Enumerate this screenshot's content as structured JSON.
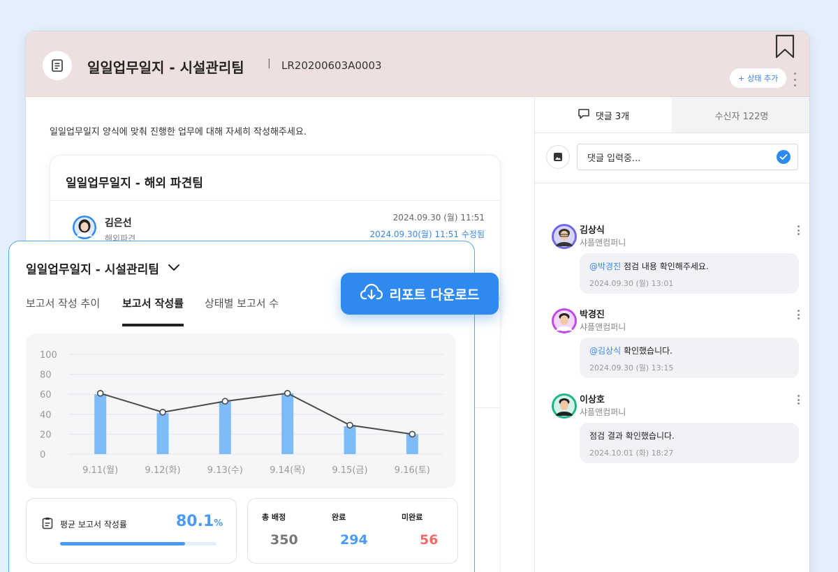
{
  "header": {
    "title": "일일업무일지 - 시설관리팀",
    "separator": "|",
    "doc_id": "LR20200603A0003",
    "status_button": "상태 추가",
    "status_plus": "+"
  },
  "main": {
    "instruction": "일일업무일지 양식에 맞춰 진행한 업무에 대해 자세히 작성해주세요.",
    "report": {
      "title": "일일업무일지 - 해외 파견팀",
      "author": "김은선",
      "team": "해외파견",
      "date": "2024.09.30 (월) 11:51",
      "edited": "2024.09.30(월) 11:51 수정됨"
    }
  },
  "side": {
    "tab_comments": "댓글 3개",
    "tab_recipients": "수신자 122명",
    "input_value": "댓글 입력중...",
    "comments": [
      {
        "name": "김상식",
        "company": "샤플앤컴퍼니",
        "mention": "@박경진",
        "text": " 점검 내용 확인해주세요.",
        "time": "2024.09.30 (월) 13:01"
      },
      {
        "name": "박경진",
        "company": "샤플앤컴퍼니",
        "mention": "@김상식",
        "text": " 확인했습니다.",
        "time": "2024.09.30 (월) 13:15"
      },
      {
        "name": "이상호",
        "company": "샤플앤컴퍼니",
        "mention": "",
        "text": "점검 결과 확인했습니다.",
        "time": "2024.10.01 (화) 18:27"
      }
    ]
  },
  "panel": {
    "title": "일일업무일지 - 시설관리팀",
    "tabs": [
      "보고서 작성 추이",
      "보고서 작성률",
      "상태별 보고서 수"
    ],
    "active_tab": 1,
    "download_label": "리포트 다운로드",
    "avg": {
      "label": "평균 보고서 작성률",
      "value": "80.1",
      "unit": "%",
      "fraction": 0.801
    },
    "counts": [
      {
        "label": "총 배정",
        "value": "350",
        "color": "#777777"
      },
      {
        "label": "완료",
        "value": "294",
        "color": "#4a9cf2"
      },
      {
        "label": "미완료",
        "value": "56",
        "color": "#f06b6b"
      }
    ]
  },
  "colors": {
    "accent": "#2f8af0",
    "bar": "#7dbcf9",
    "line": "#4a4a4a",
    "header_bg": "#efe0e0"
  },
  "chart_data": {
    "type": "bar",
    "categories": [
      "9.11(월)",
      "9.12(화)",
      "9.13(수)",
      "9.14(목)",
      "9.15(금)",
      "9.16(토)"
    ],
    "series": [
      {
        "kind": "bar",
        "values": [
          60,
          41,
          53,
          61,
          28,
          20
        ]
      },
      {
        "kind": "line",
        "values": [
          61,
          42,
          53,
          61,
          29,
          20
        ]
      }
    ],
    "yticks": [
      100,
      80,
      60,
      40,
      20,
      0
    ],
    "ylim": [
      0,
      100
    ],
    "grid": true
  }
}
